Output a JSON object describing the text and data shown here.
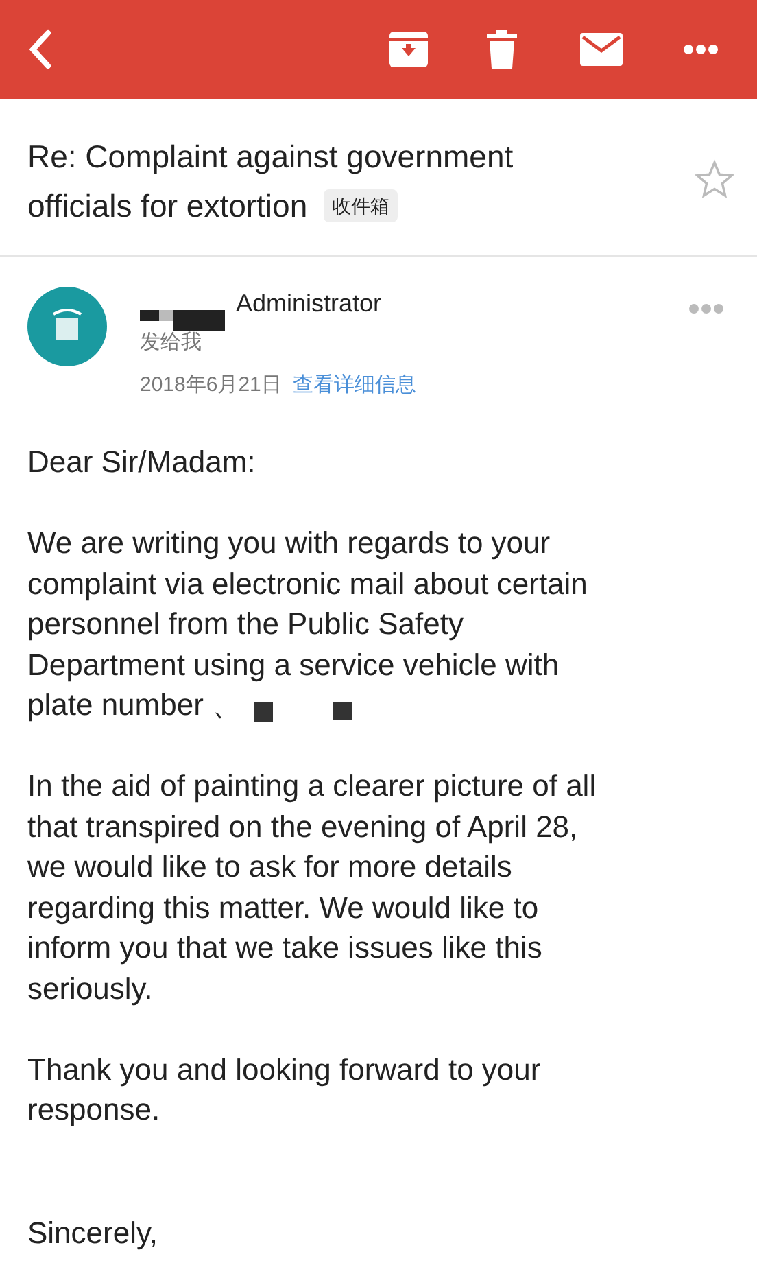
{
  "subject": {
    "title": [
      "Re: Complaint against government",
      "officials for extortion"
    ],
    "label": "收件箱",
    "starred": false
  },
  "sender": {
    "name": "Administrator",
    "recipient": "发给我",
    "date": "2018年6月21日",
    "details_link": "查看详细信息"
  },
  "body": [
    [
      "Dear Sir/Madam:"
    ],
    [
      "We are writing you with regards to your",
      "complaint via electronic mail about certain",
      "personnel from the Public Safety",
      "Department using a service vehicle with",
      "plate number 、"
    ],
    [
      "In the aid of painting a clearer picture of all",
      "that transpired on the evening of April 28,",
      "we would like to ask for more details",
      "regarding this matter. We would like to",
      "inform you that we take issues like this",
      "seriously."
    ],
    [
      "Thank you and looking forward to your",
      "response."
    ],
    [
      "Sincerely,"
    ]
  ]
}
